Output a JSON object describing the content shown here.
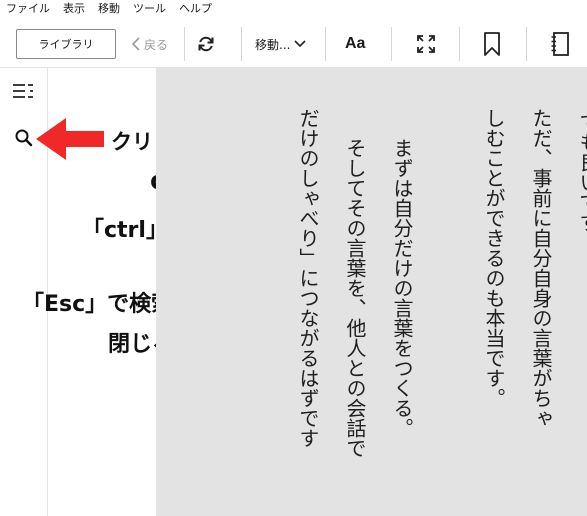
{
  "menu": [
    "ファイル",
    "表示",
    "移動",
    "ツール",
    "ヘルプ"
  ],
  "toolbar": {
    "library_label": "ライブラリ",
    "back_label": "戻る",
    "goto_label": "移動...",
    "font_label": "Aa"
  },
  "annotation": {
    "click": "クリックする",
    "or": "or",
    "shortcut": "「ctrl」+「f」",
    "esc_line1": "「Esc」で検索バーを",
    "esc_line2": "閉じる",
    "arrow_color": "#f02828"
  },
  "page": {
    "columns": [
      "ても良いです",
      "ただ、事前に自分自身の言葉がちゃ",
      "しむことができるのも本当です。",
      "まずは自分だけの言葉をつくる。",
      "そしてその言葉を、他人との会話で",
      "だけのしゃべり」につながるはずです"
    ]
  },
  "colors": {
    "page_background": "#e3e3e3",
    "accent_arrow": "#f02828"
  }
}
